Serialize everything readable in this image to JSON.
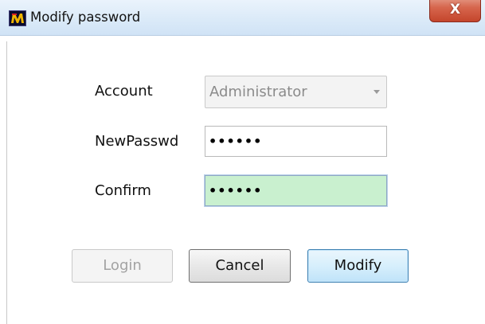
{
  "window": {
    "title": "Modify password",
    "close_glyph": "X",
    "app_icon": "app-logo-icon"
  },
  "form": {
    "account": {
      "label": "Account",
      "value": "Administrator"
    },
    "new_password": {
      "label": "NewPasswd",
      "value": "••••••"
    },
    "confirm": {
      "label": "Confirm",
      "value": "••••••"
    }
  },
  "buttons": {
    "login": "Login",
    "cancel": "Cancel",
    "modify": "Modify"
  },
  "colors": {
    "confirm_field_bg": "#c9f0cf",
    "modify_button_border": "#3c7fb1",
    "close_button": "#c4452c"
  }
}
